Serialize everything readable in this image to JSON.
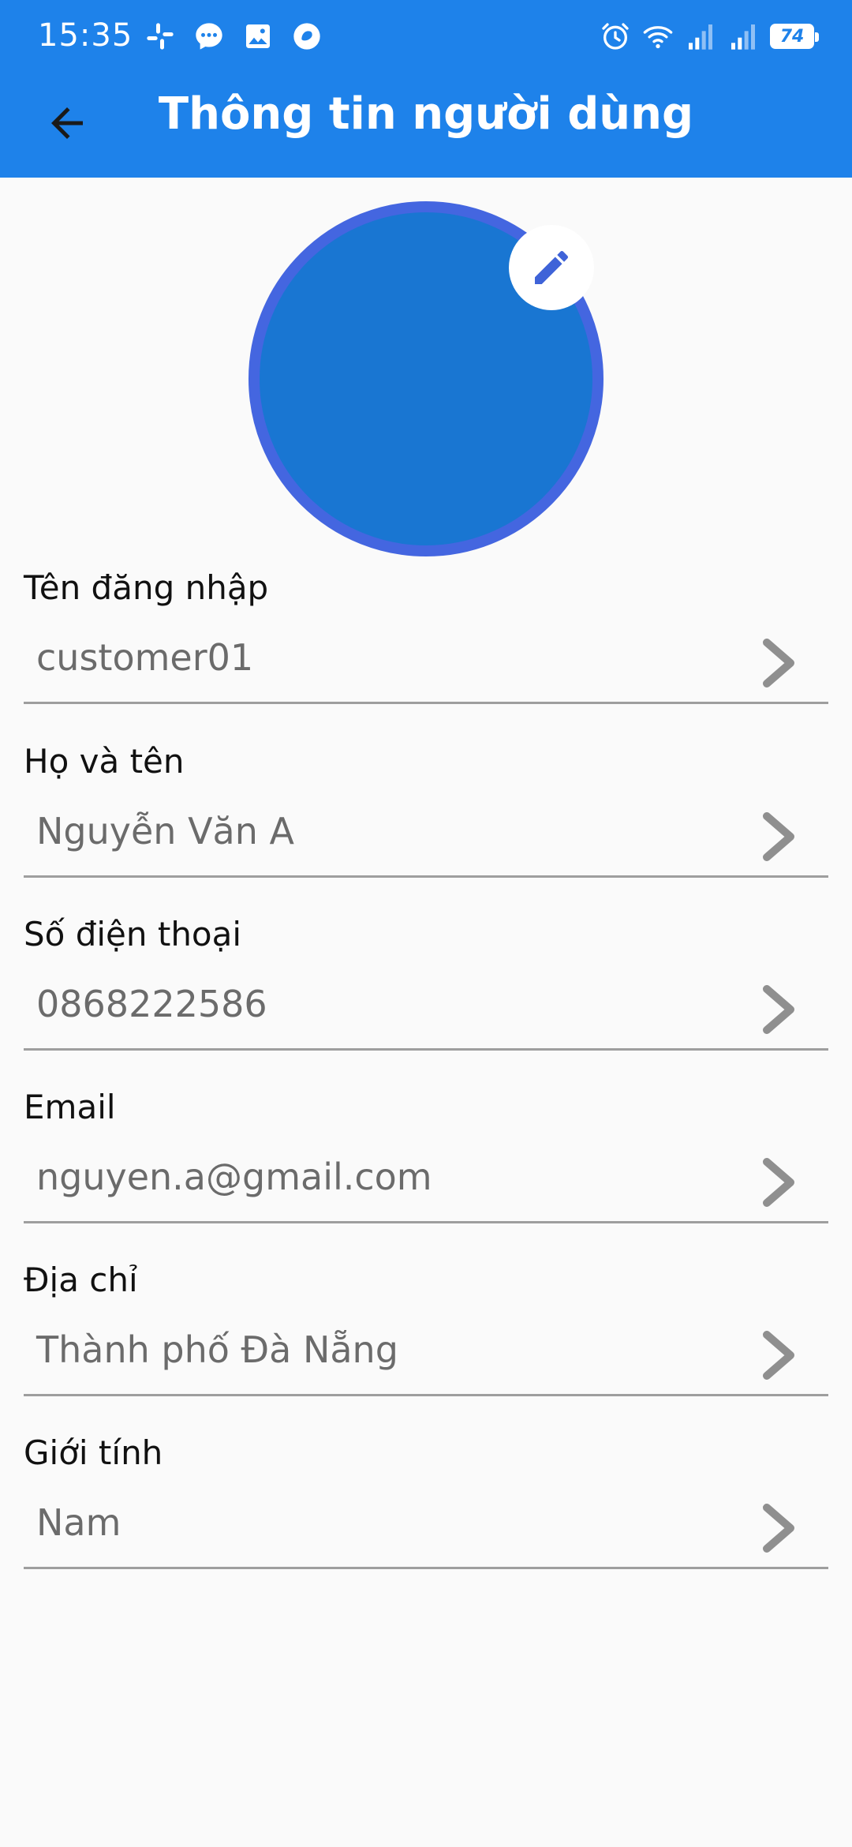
{
  "status": {
    "time": "15:35",
    "battery": "74",
    "notification_icons": [
      "slack-icon",
      "messenger-icon",
      "gallery-icon",
      "app-icon"
    ],
    "system_icons": [
      "alarm-icon",
      "wifi-icon",
      "signal-icon",
      "signal-icon"
    ]
  },
  "appbar": {
    "title": "Thông tin người dùng",
    "back_icon": "arrow-back-icon",
    "color": "#1e82ea"
  },
  "avatar": {
    "edit_icon": "pencil-icon",
    "fill_color": "#1976d2",
    "ring_color": "#4466e0"
  },
  "fields": [
    {
      "label": "Tên đăng nhập",
      "value": "customer01"
    },
    {
      "label": "Họ và tên",
      "value": "Nguyễn Văn A"
    },
    {
      "label": "Số điện thoại",
      "value": "0868222586"
    },
    {
      "label": "Email",
      "value": "nguyen.a@gmail.com"
    },
    {
      "label": "Địa chỉ",
      "value": "Thành phố Đà Nẵng"
    },
    {
      "label": "Giới tính",
      "value": "Nam"
    }
  ]
}
